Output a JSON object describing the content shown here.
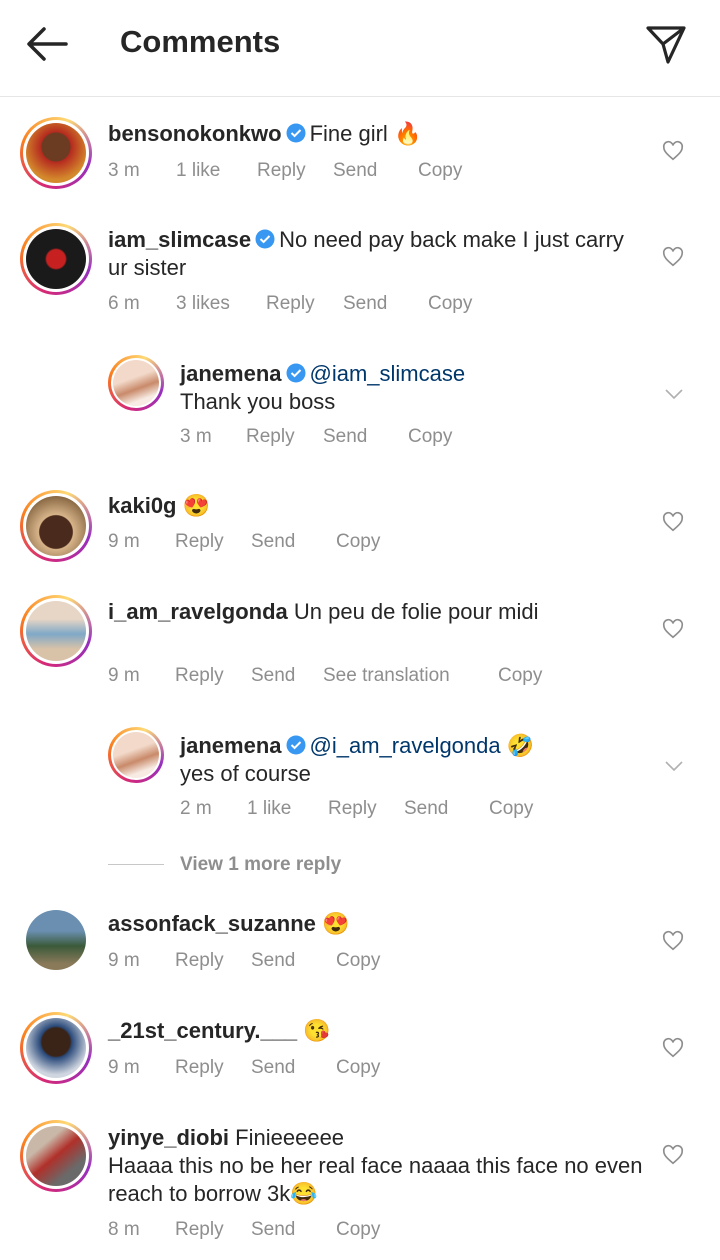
{
  "header": {
    "title": "Comments",
    "back_icon": "arrow-left-icon",
    "share_icon": "paper-plane-icon"
  },
  "comments": [
    {
      "username": "bensonokonkwo",
      "text": "Fine girl",
      "emoji": "🔥",
      "time": "3 m",
      "likes": "1 like",
      "reply": "Reply",
      "send": "Send",
      "copy": "Copy"
    },
    {
      "username": "iam_slimcase",
      "text": "No need pay back make I just carry ur sister",
      "time": "6 m",
      "likes": "3 likes",
      "reply": "Reply",
      "send": "Send",
      "copy": "Copy"
    },
    {
      "username": "janemena",
      "mention": "@iam_slimcase",
      "text": "Thank you boss",
      "time": "3 m",
      "reply": "Reply",
      "send": "Send",
      "copy": "Copy"
    },
    {
      "username": "kaki0g",
      "emoji": "😍",
      "time": "9 m",
      "reply": "Reply",
      "send": "Send",
      "copy": "Copy"
    },
    {
      "username": "i_am_ravelgonda",
      "text": "Un peu de folie pour midi",
      "time": "9 m",
      "reply": "Reply",
      "send": "Send",
      "translate": "See translation",
      "copy": "Copy"
    },
    {
      "username": "janemena",
      "mention": "@i_am_ravelgonda",
      "emoji": "🤣",
      "text": "yes of course",
      "time": "2 m",
      "likes": "1 like",
      "reply": "Reply",
      "send": "Send",
      "copy": "Copy"
    },
    {
      "username": "assonfack_suzanne",
      "emoji": "😍",
      "time": "9 m",
      "reply": "Reply",
      "send": "Send",
      "copy": "Copy"
    },
    {
      "username": "_21st_century.___",
      "emoji": "😘",
      "time": "9 m",
      "reply": "Reply",
      "send": "Send",
      "copy": "Copy"
    },
    {
      "username": "yinye_diobi",
      "text": "Finieeeeee",
      "text2": "Haaaa this no be her real face naaaa this face no even reach to borrow 3k😂",
      "time": "8 m",
      "reply": "Reply",
      "send": "Send",
      "copy": "Copy"
    }
  ],
  "view_more": "View 1 more reply",
  "colors": {
    "verified": "#3897f0",
    "mention": "#00376b",
    "meta": "#8e8e8e"
  }
}
